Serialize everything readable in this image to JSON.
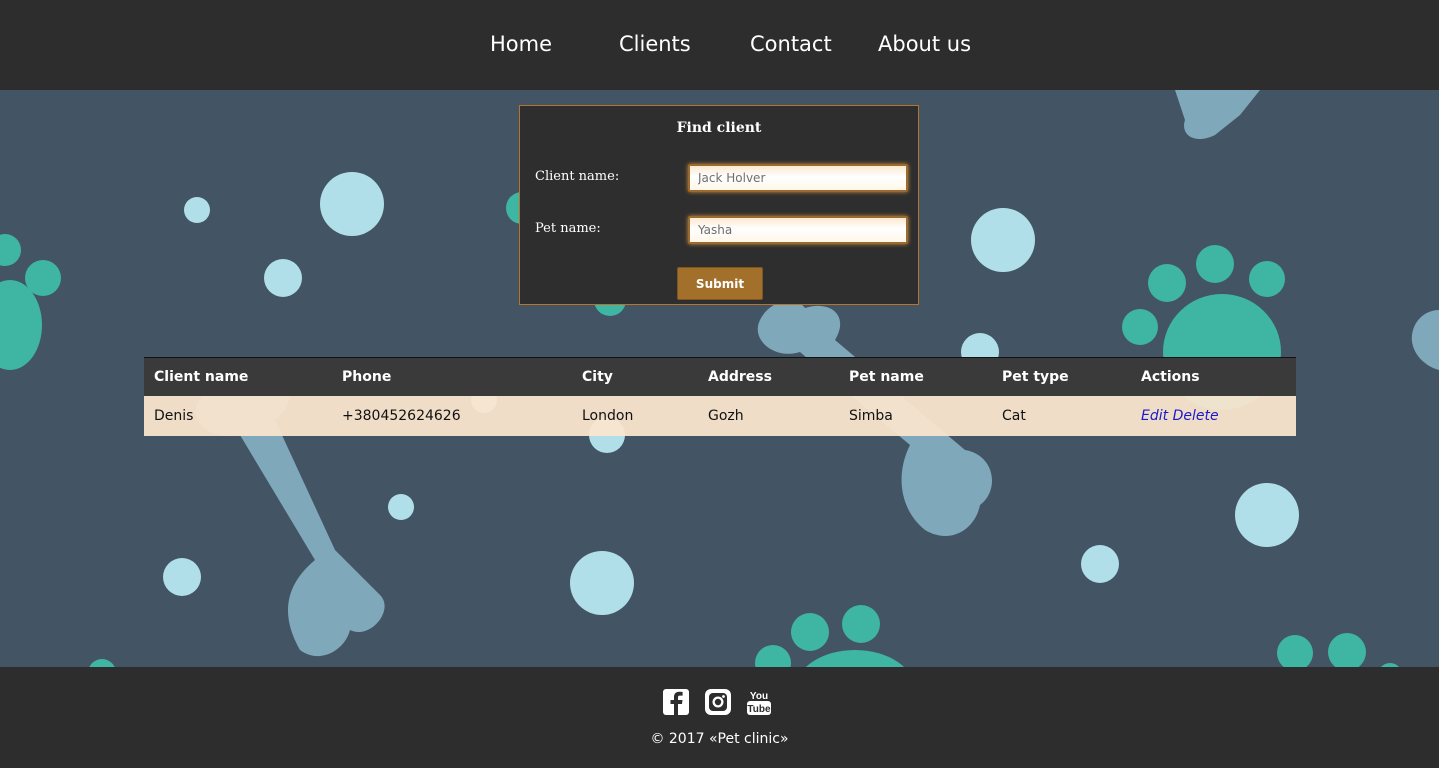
{
  "nav": {
    "items": [
      {
        "label": "Home"
      },
      {
        "label": "Clients"
      },
      {
        "label": "Contact"
      },
      {
        "label": "About us"
      }
    ]
  },
  "find_client": {
    "title": "Find client",
    "client_name_label": "Client name:",
    "client_name_placeholder": "Jack Holver",
    "pet_name_label": "Pet name:",
    "pet_name_placeholder": "Yasha",
    "submit_label": "Submit"
  },
  "table": {
    "columns": [
      "Client name",
      "Phone",
      "City",
      "Address",
      "Pet name",
      "Pet type",
      "Actions"
    ],
    "rows": [
      {
        "client_name": "Denis",
        "phone": "+380452624626",
        "city": "London",
        "address": "Gozh",
        "pet_name": "Simba",
        "pet_type": "Cat",
        "actions": {
          "edit": "Edit",
          "delete": "Delete"
        }
      }
    ]
  },
  "footer": {
    "social_icons": [
      "facebook-icon",
      "instagram-icon",
      "youtube-icon"
    ],
    "youtube_text_top": "You",
    "youtube_text_bottom": "Tube",
    "copyright": "© 2017 «Pet clinic»"
  },
  "colors": {
    "header_bg": "#2d2d2d",
    "main_bg": "#435564",
    "panel_border": "#b8732a",
    "button_bg": "#a2702a",
    "paw_teal": "#3fb5a3",
    "bubble": "#b0dfea",
    "bone": "#7fa9bb",
    "row_bg": "#fae6ce",
    "link": "#1a1acc"
  }
}
